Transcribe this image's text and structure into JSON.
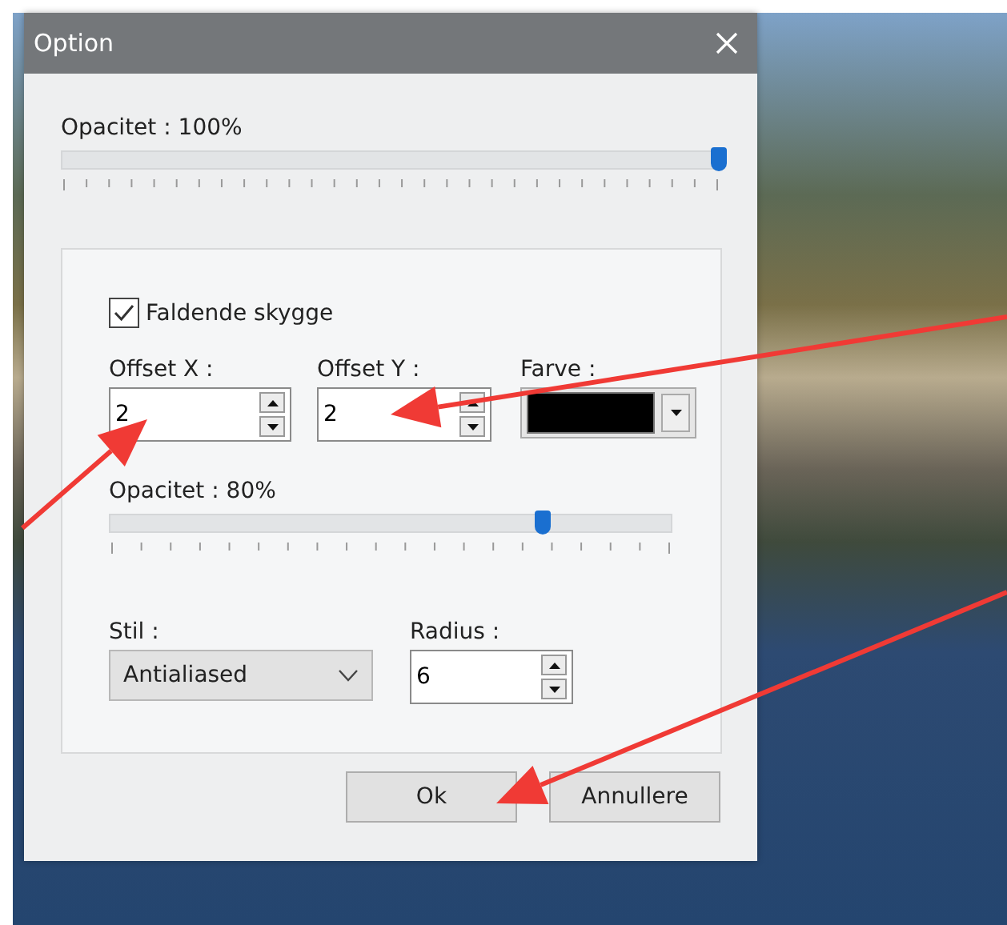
{
  "window": {
    "title": "Option"
  },
  "opacity": {
    "label": "Opacitet : 100%",
    "level": 1
  },
  "shadow": {
    "checkbox": {
      "label": "Faldende skygge",
      "checked": true
    },
    "offset_x": {
      "label": "Offset X :",
      "value": "2"
    },
    "offset_y": {
      "label": "Offset Y :",
      "value": "2"
    },
    "color": {
      "label": "Farve :",
      "color": "#000000"
    },
    "opacity": {
      "label": "Opacitet : 80%",
      "level": 0.77
    },
    "style": {
      "label": "Stil :",
      "value": "Antialiased"
    },
    "radius": {
      "label": "Radius :",
      "value": "6"
    }
  },
  "buttons": [
    "Ok",
    "Annullere"
  ]
}
